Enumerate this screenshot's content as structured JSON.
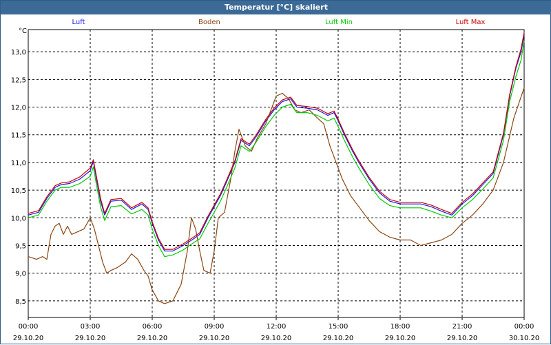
{
  "window": {
    "title": "Temperatur [°C] skaliert"
  },
  "chart_data": {
    "type": "line",
    "title": "Temperatur [°C] skaliert",
    "ylabel": "°C",
    "xlabel": "",
    "grid": true,
    "legend_position": "top",
    "ylim": [
      8.2,
      13.4
    ],
    "y_ticks": [
      "8,5",
      "9,0",
      "9,5",
      "10,0",
      "10,5",
      "11,0",
      "11,5",
      "12,0",
      "12,5",
      "13,0"
    ],
    "y_tick_values": [
      8.5,
      9.0,
      9.5,
      10.0,
      10.5,
      11.0,
      11.5,
      12.0,
      12.5,
      13.0
    ],
    "x_hours_range": [
      0,
      24
    ],
    "x_ticks": [
      {
        "hour": 0,
        "time": "00:00",
        "date": "29.10.20"
      },
      {
        "hour": 3,
        "time": "03:00",
        "date": "29.10.20"
      },
      {
        "hour": 6,
        "time": "06:00",
        "date": "29.10.20"
      },
      {
        "hour": 9,
        "time": "09:00",
        "date": "29.10.20"
      },
      {
        "hour": 12,
        "time": "12:00",
        "date": "29.10.20"
      },
      {
        "hour": 15,
        "time": "15:00",
        "date": "29.10.20"
      },
      {
        "hour": 18,
        "time": "18:00",
        "date": "29.10.20"
      },
      {
        "hour": 21,
        "time": "21:00",
        "date": "29.10.20"
      },
      {
        "hour": 24,
        "time": "00:00",
        "date": "30.10.20"
      }
    ],
    "series": [
      {
        "name": "Luft",
        "color": "#1a1ae6",
        "points": [
          [
            0,
            10.05
          ],
          [
            0.5,
            10.1
          ],
          [
            0.9,
            10.35
          ],
          [
            1.3,
            10.55
          ],
          [
            1.6,
            10.6
          ],
          [
            2.0,
            10.62
          ],
          [
            2.5,
            10.7
          ],
          [
            3.0,
            10.85
          ],
          [
            3.15,
            11.02
          ],
          [
            3.3,
            10.7
          ],
          [
            3.5,
            10.3
          ],
          [
            3.7,
            10.05
          ],
          [
            4.0,
            10.3
          ],
          [
            4.5,
            10.32
          ],
          [
            5.0,
            10.15
          ],
          [
            5.5,
            10.25
          ],
          [
            5.8,
            10.15
          ],
          [
            6.0,
            9.9
          ],
          [
            6.3,
            9.6
          ],
          [
            6.6,
            9.4
          ],
          [
            7.0,
            9.4
          ],
          [
            7.5,
            9.5
          ],
          [
            8.0,
            9.62
          ],
          [
            8.3,
            9.7
          ],
          [
            8.7,
            10.0
          ],
          [
            9.0,
            10.2
          ],
          [
            9.3,
            10.4
          ],
          [
            9.6,
            10.65
          ],
          [
            10.0,
            11.0
          ],
          [
            10.3,
            11.4
          ],
          [
            10.7,
            11.3
          ],
          [
            11.0,
            11.45
          ],
          [
            11.5,
            11.75
          ],
          [
            11.9,
            11.95
          ],
          [
            12.3,
            12.1
          ],
          [
            12.7,
            12.15
          ],
          [
            13.0,
            12.0
          ],
          [
            13.5,
            11.98
          ],
          [
            14.0,
            11.95
          ],
          [
            14.5,
            11.85
          ],
          [
            14.8,
            11.9
          ],
          [
            15.0,
            11.75
          ],
          [
            15.3,
            11.5
          ],
          [
            15.7,
            11.2
          ],
          [
            16.0,
            11.0
          ],
          [
            16.5,
            10.7
          ],
          [
            17.0,
            10.45
          ],
          [
            17.5,
            10.3
          ],
          [
            18.0,
            10.25
          ],
          [
            18.5,
            10.25
          ],
          [
            19.0,
            10.25
          ],
          [
            19.5,
            10.2
          ],
          [
            20.0,
            10.12
          ],
          [
            20.5,
            10.05
          ],
          [
            21.0,
            10.25
          ],
          [
            21.5,
            10.4
          ],
          [
            22.0,
            10.6
          ],
          [
            22.5,
            10.8
          ],
          [
            23.0,
            11.5
          ],
          [
            23.3,
            12.2
          ],
          [
            23.6,
            12.7
          ],
          [
            23.85,
            13.0
          ],
          [
            24.0,
            13.3
          ]
        ]
      },
      {
        "name": "Boden",
        "color": "#8b4513",
        "points": [
          [
            0,
            9.3
          ],
          [
            0.4,
            9.25
          ],
          [
            0.7,
            9.3
          ],
          [
            0.9,
            9.25
          ],
          [
            1.1,
            9.7
          ],
          [
            1.3,
            9.85
          ],
          [
            1.5,
            9.9
          ],
          [
            1.7,
            9.7
          ],
          [
            1.9,
            9.85
          ],
          [
            2.1,
            9.7
          ],
          [
            2.4,
            9.75
          ],
          [
            2.7,
            9.8
          ],
          [
            3.0,
            10.0
          ],
          [
            3.2,
            9.8
          ],
          [
            3.4,
            9.5
          ],
          [
            3.6,
            9.2
          ],
          [
            3.8,
            9.0
          ],
          [
            4.0,
            9.05
          ],
          [
            4.3,
            9.1
          ],
          [
            4.7,
            9.2
          ],
          [
            5.0,
            9.35
          ],
          [
            5.3,
            9.25
          ],
          [
            5.6,
            9.05
          ],
          [
            5.8,
            8.95
          ],
          [
            6.0,
            8.7
          ],
          [
            6.3,
            8.5
          ],
          [
            6.6,
            8.45
          ],
          [
            7.0,
            8.5
          ],
          [
            7.4,
            8.8
          ],
          [
            7.7,
            9.4
          ],
          [
            7.9,
            10.0
          ],
          [
            8.1,
            9.8
          ],
          [
            8.3,
            9.4
          ],
          [
            8.5,
            9.05
          ],
          [
            8.8,
            9.0
          ],
          [
            9.0,
            9.4
          ],
          [
            9.2,
            10.0
          ],
          [
            9.5,
            10.1
          ],
          [
            9.8,
            10.7
          ],
          [
            10.0,
            11.2
          ],
          [
            10.2,
            11.6
          ],
          [
            10.5,
            11.3
          ],
          [
            10.8,
            11.2
          ],
          [
            11.1,
            11.45
          ],
          [
            11.5,
            11.7
          ],
          [
            11.8,
            12.0
          ],
          [
            12.0,
            12.2
          ],
          [
            12.3,
            12.25
          ],
          [
            12.6,
            12.15
          ],
          [
            12.9,
            11.95
          ],
          [
            13.2,
            11.9
          ],
          [
            13.6,
            11.95
          ],
          [
            14.0,
            11.8
          ],
          [
            14.3,
            11.7
          ],
          [
            14.6,
            11.3
          ],
          [
            14.9,
            11.0
          ],
          [
            15.2,
            10.7
          ],
          [
            15.6,
            10.4
          ],
          [
            16.0,
            10.2
          ],
          [
            16.5,
            9.95
          ],
          [
            17.0,
            9.75
          ],
          [
            17.5,
            9.65
          ],
          [
            18.0,
            9.6
          ],
          [
            18.5,
            9.6
          ],
          [
            19.0,
            9.5
          ],
          [
            19.5,
            9.55
          ],
          [
            20.0,
            9.6
          ],
          [
            20.5,
            9.7
          ],
          [
            21.0,
            9.9
          ],
          [
            21.5,
            10.05
          ],
          [
            22.0,
            10.25
          ],
          [
            22.5,
            10.5
          ],
          [
            23.0,
            11.0
          ],
          [
            23.5,
            11.8
          ],
          [
            24.0,
            12.35
          ]
        ]
      },
      {
        "name": "Luft Min",
        "color": "#00cc00",
        "points": [
          [
            0,
            10.0
          ],
          [
            0.5,
            10.05
          ],
          [
            0.9,
            10.3
          ],
          [
            1.3,
            10.5
          ],
          [
            1.6,
            10.55
          ],
          [
            2.0,
            10.55
          ],
          [
            2.5,
            10.62
          ],
          [
            3.0,
            10.75
          ],
          [
            3.15,
            10.92
          ],
          [
            3.3,
            10.6
          ],
          [
            3.5,
            10.2
          ],
          [
            3.7,
            9.95
          ],
          [
            4.0,
            10.2
          ],
          [
            4.5,
            10.22
          ],
          [
            5.0,
            10.07
          ],
          [
            5.5,
            10.15
          ],
          [
            5.8,
            10.05
          ],
          [
            6.0,
            9.8
          ],
          [
            6.3,
            9.5
          ],
          [
            6.6,
            9.3
          ],
          [
            7.0,
            9.33
          ],
          [
            7.5,
            9.42
          ],
          [
            8.0,
            9.55
          ],
          [
            8.3,
            9.62
          ],
          [
            8.7,
            9.9
          ],
          [
            9.0,
            10.1
          ],
          [
            9.3,
            10.3
          ],
          [
            9.6,
            10.55
          ],
          [
            10.0,
            10.9
          ],
          [
            10.3,
            11.3
          ],
          [
            10.7,
            11.2
          ],
          [
            11.0,
            11.35
          ],
          [
            11.5,
            11.65
          ],
          [
            11.9,
            11.85
          ],
          [
            12.3,
            12.0
          ],
          [
            12.7,
            12.05
          ],
          [
            13.0,
            11.9
          ],
          [
            13.5,
            11.9
          ],
          [
            14.0,
            11.85
          ],
          [
            14.5,
            11.75
          ],
          [
            14.8,
            11.8
          ],
          [
            15.0,
            11.65
          ],
          [
            15.3,
            11.4
          ],
          [
            15.7,
            11.1
          ],
          [
            16.0,
            10.9
          ],
          [
            16.5,
            10.6
          ],
          [
            17.0,
            10.35
          ],
          [
            17.5,
            10.22
          ],
          [
            18.0,
            10.18
          ],
          [
            18.5,
            10.18
          ],
          [
            19.0,
            10.18
          ],
          [
            19.5,
            10.12
          ],
          [
            20.0,
            10.05
          ],
          [
            20.5,
            10.0
          ],
          [
            21.0,
            10.18
          ],
          [
            21.5,
            10.33
          ],
          [
            22.0,
            10.52
          ],
          [
            22.5,
            10.72
          ],
          [
            23.0,
            11.4
          ],
          [
            23.3,
            12.1
          ],
          [
            23.6,
            12.55
          ],
          [
            23.85,
            12.85
          ],
          [
            24.0,
            13.2
          ]
        ]
      },
      {
        "name": "Luft Max",
        "color": "#cc0000",
        "points": [
          [
            0,
            10.08
          ],
          [
            0.5,
            10.13
          ],
          [
            0.9,
            10.38
          ],
          [
            1.3,
            10.58
          ],
          [
            1.6,
            10.63
          ],
          [
            2.0,
            10.65
          ],
          [
            2.5,
            10.74
          ],
          [
            3.0,
            10.9
          ],
          [
            3.15,
            11.05
          ],
          [
            3.3,
            10.75
          ],
          [
            3.5,
            10.35
          ],
          [
            3.7,
            10.08
          ],
          [
            4.0,
            10.33
          ],
          [
            4.5,
            10.35
          ],
          [
            5.0,
            10.18
          ],
          [
            5.5,
            10.28
          ],
          [
            5.8,
            10.18
          ],
          [
            6.0,
            9.93
          ],
          [
            6.3,
            9.63
          ],
          [
            6.6,
            9.43
          ],
          [
            7.0,
            9.43
          ],
          [
            7.5,
            9.53
          ],
          [
            8.0,
            9.65
          ],
          [
            8.3,
            9.73
          ],
          [
            8.7,
            10.03
          ],
          [
            9.0,
            10.23
          ],
          [
            9.3,
            10.43
          ],
          [
            9.6,
            10.68
          ],
          [
            10.0,
            11.03
          ],
          [
            10.3,
            11.43
          ],
          [
            10.7,
            11.33
          ],
          [
            11.0,
            11.48
          ],
          [
            11.5,
            11.78
          ],
          [
            11.9,
            11.98
          ],
          [
            12.3,
            12.13
          ],
          [
            12.7,
            12.18
          ],
          [
            13.0,
            12.03
          ],
          [
            13.5,
            12.01
          ],
          [
            14.0,
            11.98
          ],
          [
            14.5,
            11.88
          ],
          [
            14.8,
            11.93
          ],
          [
            15.0,
            11.78
          ],
          [
            15.3,
            11.53
          ],
          [
            15.7,
            11.23
          ],
          [
            16.0,
            11.03
          ],
          [
            16.5,
            10.73
          ],
          [
            17.0,
            10.48
          ],
          [
            17.5,
            10.33
          ],
          [
            18.0,
            10.28
          ],
          [
            18.5,
            10.28
          ],
          [
            19.0,
            10.28
          ],
          [
            19.5,
            10.23
          ],
          [
            20.0,
            10.15
          ],
          [
            20.5,
            10.08
          ],
          [
            21.0,
            10.28
          ],
          [
            21.5,
            10.43
          ],
          [
            22.0,
            10.63
          ],
          [
            22.5,
            10.83
          ],
          [
            23.0,
            11.53
          ],
          [
            23.3,
            12.23
          ],
          [
            23.6,
            12.73
          ],
          [
            23.85,
            13.05
          ],
          [
            24.0,
            13.35
          ]
        ]
      }
    ]
  }
}
